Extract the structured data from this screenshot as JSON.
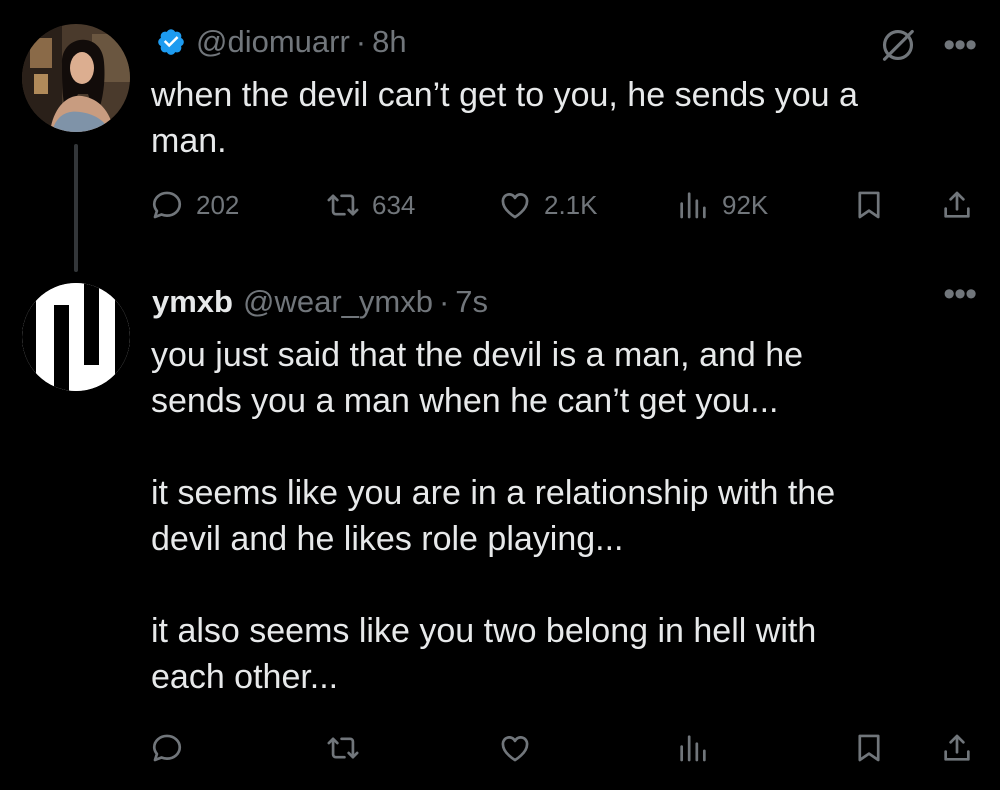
{
  "original_tweet": {
    "verified": true,
    "handle": "@diomuarr",
    "separator": "·",
    "time": "8h",
    "text": "when the devil can’t get to you, he sends you a\nman.",
    "stats": {
      "replies": "202",
      "reposts": "634",
      "likes": "2.1K",
      "views": "92K"
    }
  },
  "reply_tweet": {
    "display_name": "ymxb",
    "handle": "@wear_ymxb",
    "separator": "·",
    "time": "7s",
    "text": "you just said that the devil is a man, and he\nsends you a man when he can’t get you...\n\nit seems like you are in a relationship with the\ndevil and he likes role playing...\n\nit also seems like you two belong in hell with\neach other..."
  },
  "icons": {
    "verified": "verified-badge-icon",
    "grok": "grok-icon",
    "more": "more-icon",
    "reply": "reply-icon",
    "repost": "repost-icon",
    "like": "like-icon",
    "views": "views-icon",
    "bookmark": "bookmark-icon",
    "share": "share-icon"
  },
  "colors": {
    "background": "#000000",
    "text_primary": "#e7e9ea",
    "text_secondary": "#71767b",
    "verified_blue": "#1d9bf0",
    "thread_line": "#333639"
  }
}
